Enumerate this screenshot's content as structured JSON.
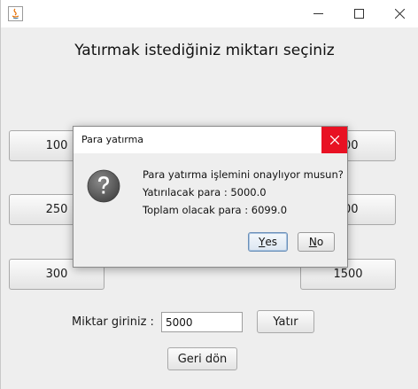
{
  "window": {
    "controls": {
      "minimize_icon": "minimize-icon",
      "maximize_icon": "maximize-icon",
      "close_icon": "close-icon"
    }
  },
  "main": {
    "heading": "Yatırmak istediğiniz miktarı seçiniz",
    "left_buttons": [
      "100",
      "250",
      "300"
    ],
    "right_buttons": [
      "00",
      "00",
      "1500"
    ],
    "amount_label": "Miktar giriniz :",
    "amount_value": "5000",
    "deposit_button": "Yatır",
    "back_button": "Geri dön"
  },
  "dialog": {
    "title": "Para yatırma",
    "lines": [
      "Para yatırma işlemini onaylıyor musun?",
      "Yatırılacak para : 5000.0",
      "Toplam olacak para : 6099.0"
    ],
    "yes_mnemonic": "Y",
    "yes_rest": "es",
    "no_mnemonic": "N",
    "no_rest": "o",
    "icon": "question-icon",
    "close_color": "#e81123"
  }
}
